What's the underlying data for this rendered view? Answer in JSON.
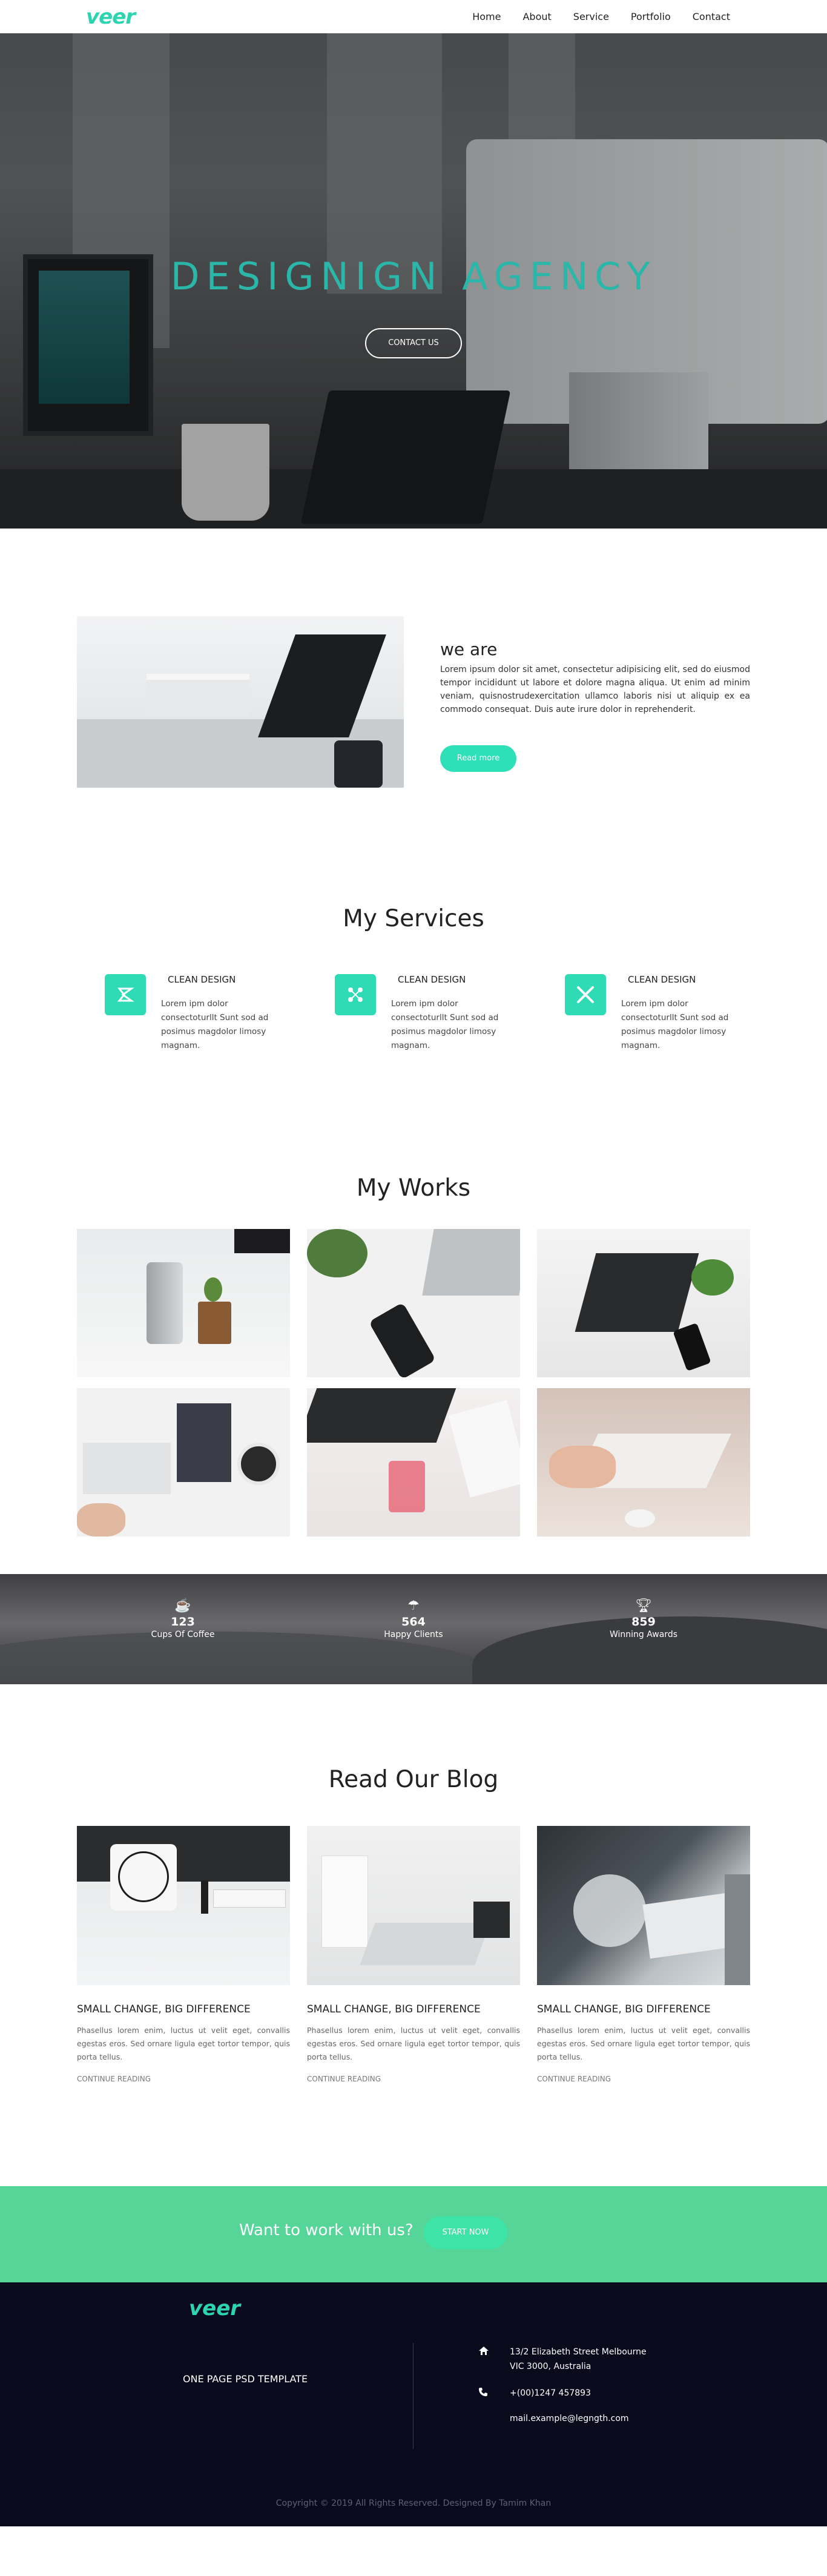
{
  "nav": {
    "logo": "veer",
    "items": [
      "Home",
      "About",
      "Service",
      "Portfolio",
      "Contact"
    ]
  },
  "hero": {
    "title": "DESIGNIGN AGENCY",
    "button": "CONTACT US"
  },
  "about": {
    "title": "we are",
    "text": "Lorem ipsum dolor sit amet, consectetur adipisicing elit, sed do eiusmod tempor incididunt ut labore et dolore magna aliqua. Ut enim ad minim veniam, quisnostrudexercitation ullamco laboris nisi ut aliquip ex ea commodo consequat. Duis aute irure dolor in reprehenderit.",
    "button": "Read more"
  },
  "services": {
    "title": "My Services",
    "items": [
      {
        "title": "CLEAN DESIGN",
        "text": "Lorem ipm dolor consectoturllt Sunt sod ad posimus magdolor limosy magnam.",
        "icon": "design-icon"
      },
      {
        "title": "CLEAN DESIGN",
        "text": "Lorem ipm dolor consectoturllt Sunt sod ad posimus magdolor limosy magnam.",
        "icon": "network-icon"
      },
      {
        "title": "CLEAN DESIGN",
        "text": "Lorem ipm dolor consectoturllt Sunt sod ad posimus magdolor limosy magnam.",
        "icon": "tools-icon"
      }
    ]
  },
  "works": {
    "title": "My Works"
  },
  "stats": [
    {
      "number": "123",
      "label": "Cups Of Coffee",
      "icon": "coffee-icon"
    },
    {
      "number": "564",
      "label": "Happy Clients",
      "icon": "umbrella-icon"
    },
    {
      "number": "859",
      "label": "Winning Awards",
      "icon": "trophy-icon"
    }
  ],
  "blog": {
    "title": "Read Our Blog",
    "posts": [
      {
        "title": "SMALL CHANGE, BIG DIFFERENCE",
        "text": "Phasellus lorem enim, luctus ut velit eget, convallis egestas eros. Sed ornare ligula eget tortor tempor, quis porta tellus.",
        "link": "CONTINUE READING"
      },
      {
        "title": "SMALL CHANGE, BIG DIFFERENCE",
        "text": "Phasellus lorem enim, luctus ut velit eget, convallis egestas eros. Sed ornare ligula eget tortor tempor, quis porta tellus.",
        "link": "CONTINUE READING"
      },
      {
        "title": "SMALL CHANGE, BIG DIFFERENCE",
        "text": "Phasellus lorem enim, luctus ut velit eget, convallis egestas eros. Sed ornare ligula eget tortor tempor, quis porta tellus.",
        "link": "CONTINUE READING"
      }
    ]
  },
  "cta": {
    "text": "Want to work with us?",
    "button": "START NOW"
  },
  "footer": {
    "logo": "veer",
    "tagline": "ONE PAGE PSD TEMPLATE",
    "address_line1": "13/2 Elizabeth Street Melbourne",
    "address_line2": "VIC 3000, Australia",
    "phone": "+(00)1247 457893",
    "email": "mail.example@legngth.com",
    "copyright": "Copyright © 2019 All Rights Reserved. Designed By Tamim Khan"
  },
  "colors": {
    "accent": "#2edbb4",
    "cta_bg": "#55d597",
    "footer_bg": "#090a1c"
  }
}
